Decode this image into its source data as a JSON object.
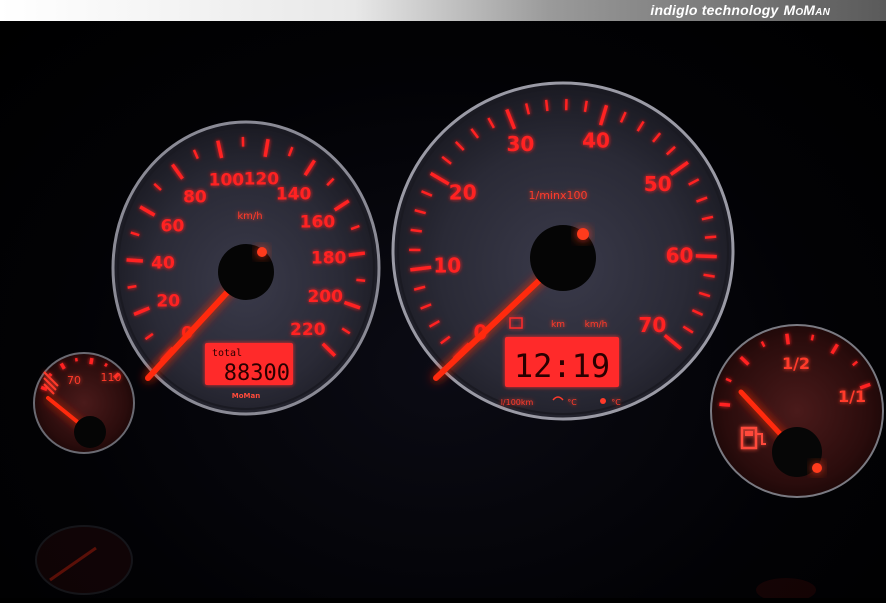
{
  "banner": {
    "text": "indiglo technology",
    "brand": "MoMan"
  },
  "speedometer": {
    "labels": [
      "0",
      "20",
      "40",
      "60",
      "80",
      "100",
      "120",
      "140",
      "160",
      "180",
      "200",
      "220"
    ],
    "unit": "km/h",
    "odometer_label": "total",
    "odometer_value": "88300",
    "brand": "MoMan",
    "needle_value_kmh": 0
  },
  "tachometer": {
    "labels": [
      "0",
      "10",
      "20",
      "30",
      "40",
      "50",
      "60",
      "70"
    ],
    "unit": "1/minx100",
    "display_units": [
      "km",
      "km/h"
    ],
    "clock": "12:19",
    "bottom_labels": [
      "l/100km",
      "°C",
      "°C"
    ],
    "needle_value": 0
  },
  "temp_gauge": {
    "labels": [
      "70",
      "110"
    ]
  },
  "fuel_gauge": {
    "labels": [
      "1/2",
      "1/1"
    ],
    "icon": "fuel-pump-icon"
  },
  "colors": {
    "glow": "#ff2020",
    "needle": "#ff3a1a",
    "lcd_bg": "#ff2a2a",
    "lcd_text": "#2a0000"
  }
}
